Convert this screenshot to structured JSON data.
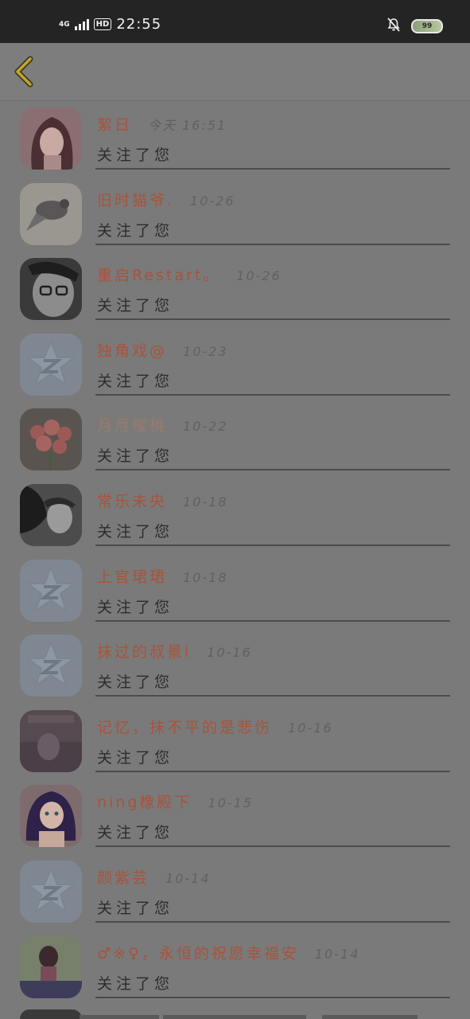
{
  "status_bar": {
    "network": "4G",
    "hd": "HD",
    "time": "22:55",
    "battery": "99"
  },
  "colors": {
    "name": "#a8533a",
    "name_faded": "#9a7a6c",
    "date": "#606060",
    "message": "#2c2c2c",
    "back_arrow": "#c2a52e",
    "background": "#7a7a7a"
  },
  "header": {
    "back_icon": "back-arrow-icon"
  },
  "items": [
    {
      "name": "絮日",
      "date": "今天 16:51",
      "message": "关注了您",
      "avatar": "photo-anime-girl"
    },
    {
      "name": "旧时猫爷.",
      "date": "10-26",
      "message": "关注了您",
      "avatar": "photo-bird"
    },
    {
      "name": "重启Restart。",
      "date": "10-26",
      "message": "关注了您",
      "avatar": "photo-man-glasses"
    },
    {
      "name": "独角戏@",
      "date": "10-23",
      "message": "关注了您",
      "avatar": "default-qzone-icon"
    },
    {
      "name": "月月樱桃",
      "date": "10-22",
      "message": "关注了您",
      "avatar": "photo-flowers",
      "faded": true
    },
    {
      "name": "常乐未央",
      "date": "10-18",
      "message": "关注了您",
      "avatar": "photo-couple"
    },
    {
      "name": "上官珺珺",
      "date": "10-18",
      "message": "关注了您",
      "avatar": "default-qzone-icon"
    },
    {
      "name": "抹过的叔景i",
      "date": "10-16",
      "message": "关注了您",
      "avatar": "default-qzone-icon"
    },
    {
      "name": "记忆，抹不平的是悲伤",
      "date": "10-16",
      "message": "关注了您",
      "avatar": "photo-dark-portrait"
    },
    {
      "name": "ning橡殿下",
      "date": "10-15",
      "message": "关注了您",
      "avatar": "photo-anime-girl-purple"
    },
    {
      "name": "颜紫芸",
      "date": "10-14",
      "message": "关注了您",
      "avatar": "default-qzone-icon"
    },
    {
      "name": "♂※♀，永恒的祝愿幸福安",
      "date": "10-14",
      "message": "关注了您",
      "avatar": "photo-girl-text"
    }
  ]
}
